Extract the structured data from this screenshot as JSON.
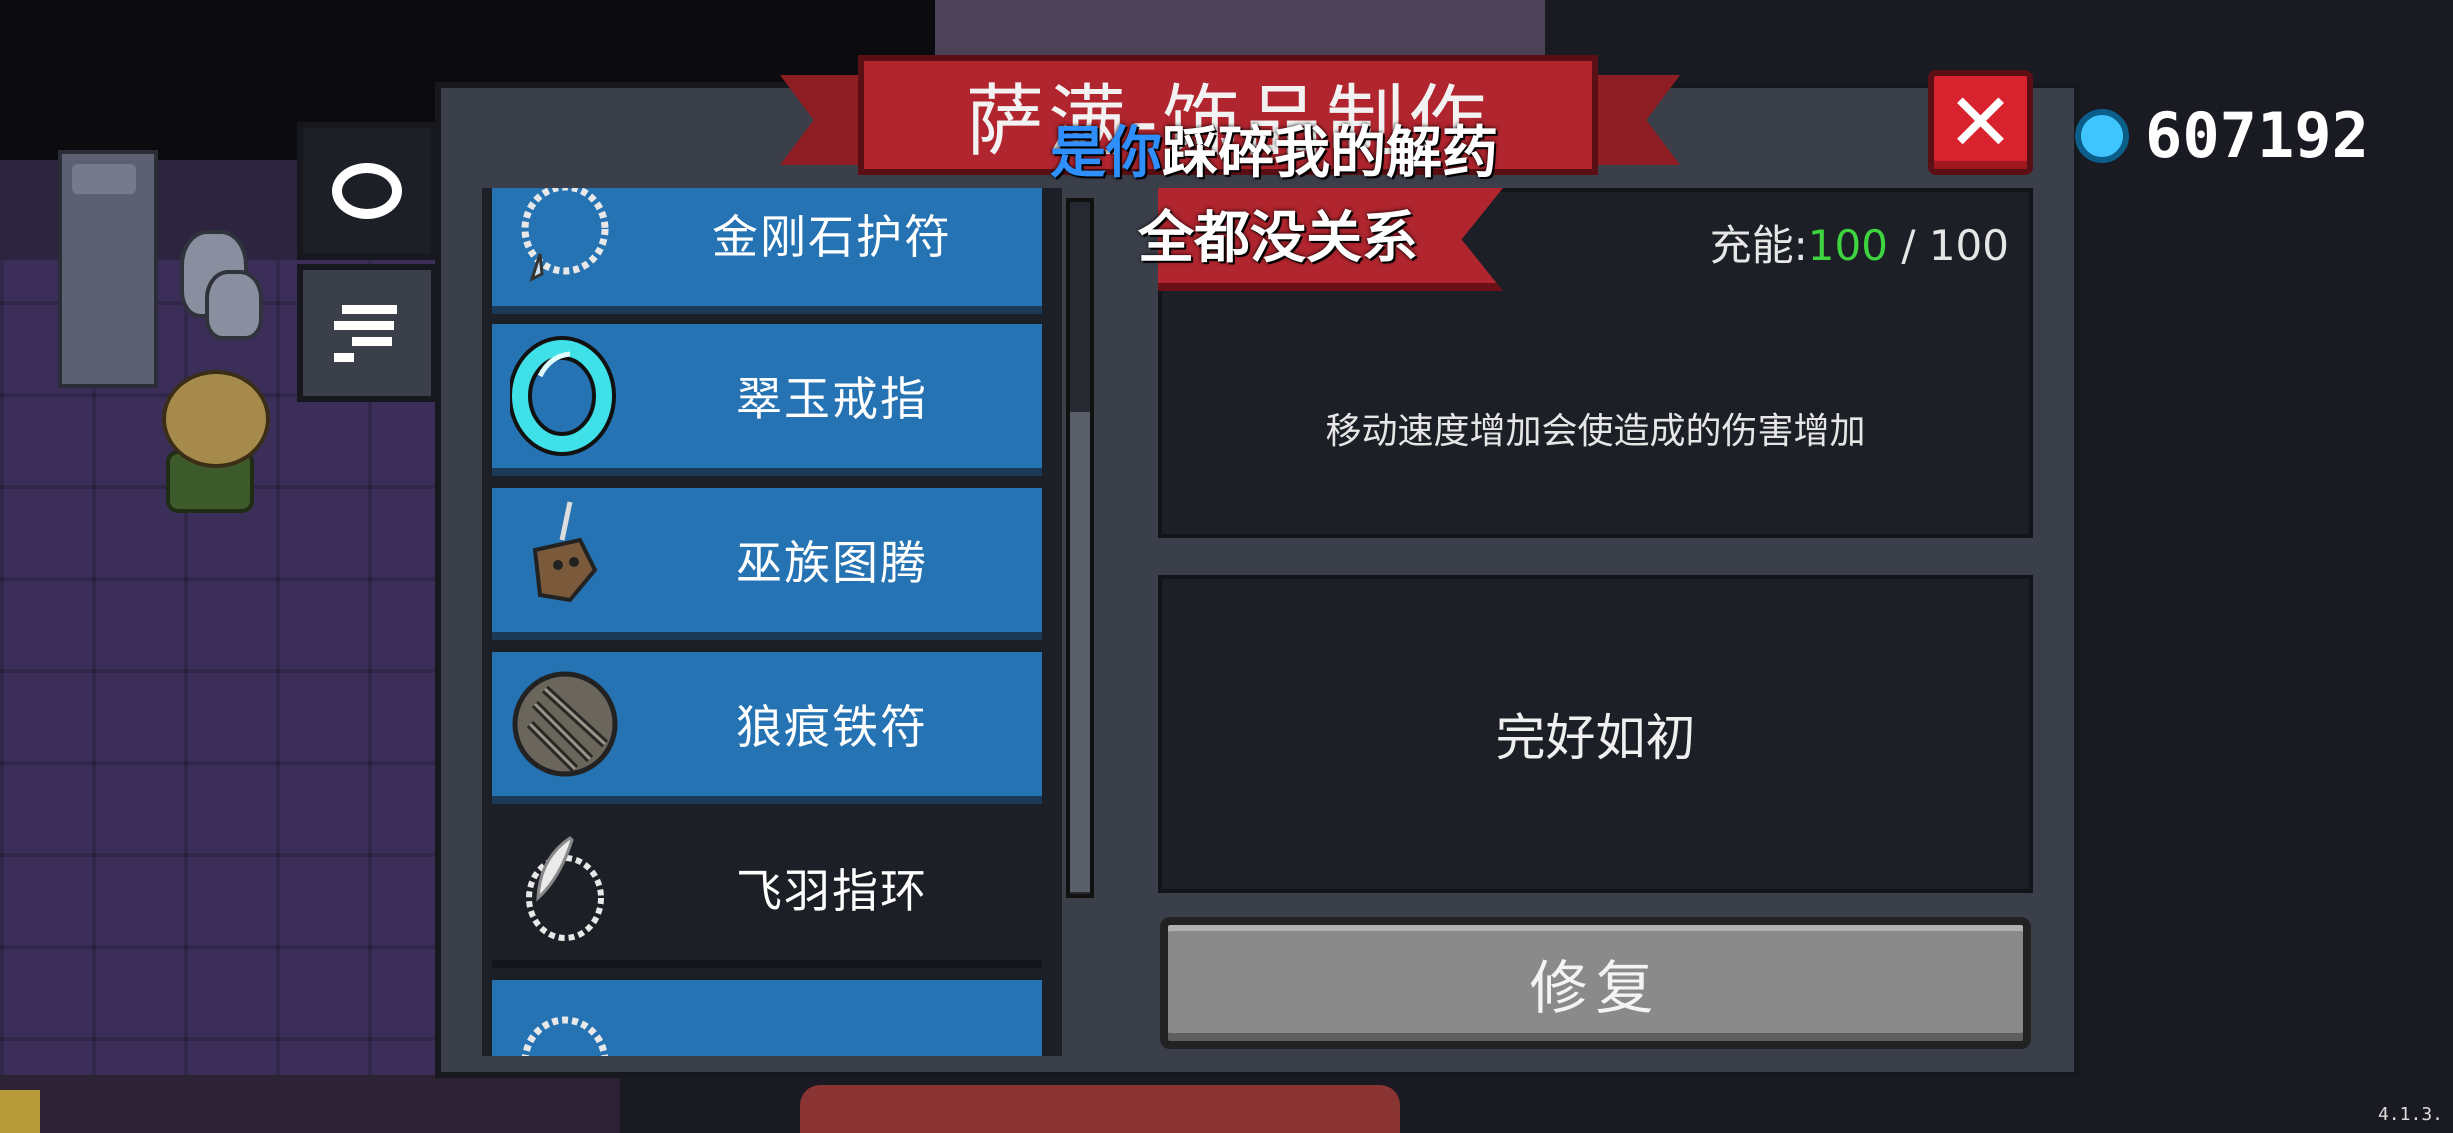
{
  "title": "萨满-饰品制作",
  "currency": {
    "amount": "607192",
    "icon": "gem-icon"
  },
  "close_label": "✕",
  "tabs": [
    {
      "name": "ring-tab",
      "icon": "ring-icon",
      "active": true
    },
    {
      "name": "list-tab",
      "icon": "list-icon",
      "active": false
    }
  ],
  "items": [
    {
      "label": "金刚石护符",
      "icon": "necklace-icon",
      "selected": false
    },
    {
      "label": "翠玉戒指",
      "icon": "jade-ring-icon",
      "selected": false
    },
    {
      "label": "巫族图腾",
      "icon": "totem-icon",
      "selected": false
    },
    {
      "label": "狼痕铁符",
      "icon": "iron-charm-icon",
      "selected": false
    },
    {
      "label": "飞羽指环",
      "icon": "feather-ring-icon",
      "selected": true
    },
    {
      "label": "",
      "icon": "necklace-icon",
      "selected": false
    }
  ],
  "detail": {
    "energy_label": "充能:",
    "energy_current": "100",
    "energy_sep": " / ",
    "energy_max": "100",
    "description": "移动速度增加会使造成的伤害增加"
  },
  "status": "完好如初",
  "repair_label": "修复",
  "subtitles": {
    "line1_highlight": "是你",
    "line1_rest": "踩碎我的解药",
    "line2": "全都没关系"
  },
  "version": "4.1.3."
}
